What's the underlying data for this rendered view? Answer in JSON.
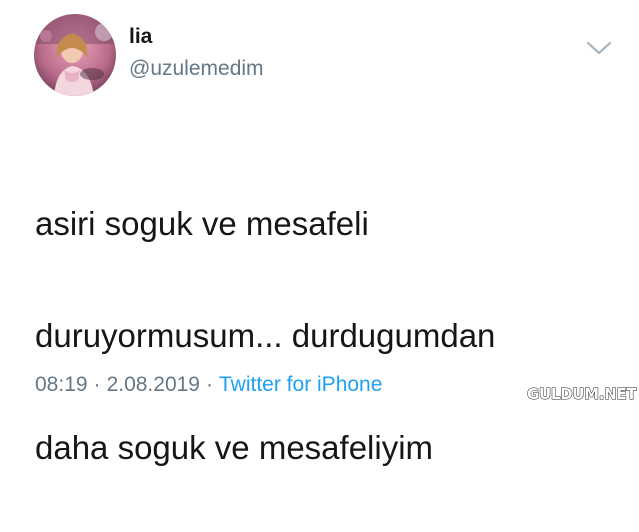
{
  "tweet": {
    "author": {
      "display_name": "lia",
      "handle": "@uzulemedim",
      "avatar_icon": "profile-photo"
    },
    "menu_icon": "chevron-down-icon",
    "text_lines": [
      "asiri soguk ve mesafeli",
      "duruyormusum... durdugumdan",
      "daha soguk ve mesafeliyim"
    ],
    "time": "08:19",
    "separator": "·",
    "date": "2.08.2019",
    "source": "Twitter for iPhone"
  },
  "watermark": {
    "text": "GULDUM.NET"
  },
  "colors": {
    "text_primary": "#14171a",
    "text_secondary": "#657786",
    "link": "#1da1f2",
    "chevron": "#aab8c2"
  }
}
